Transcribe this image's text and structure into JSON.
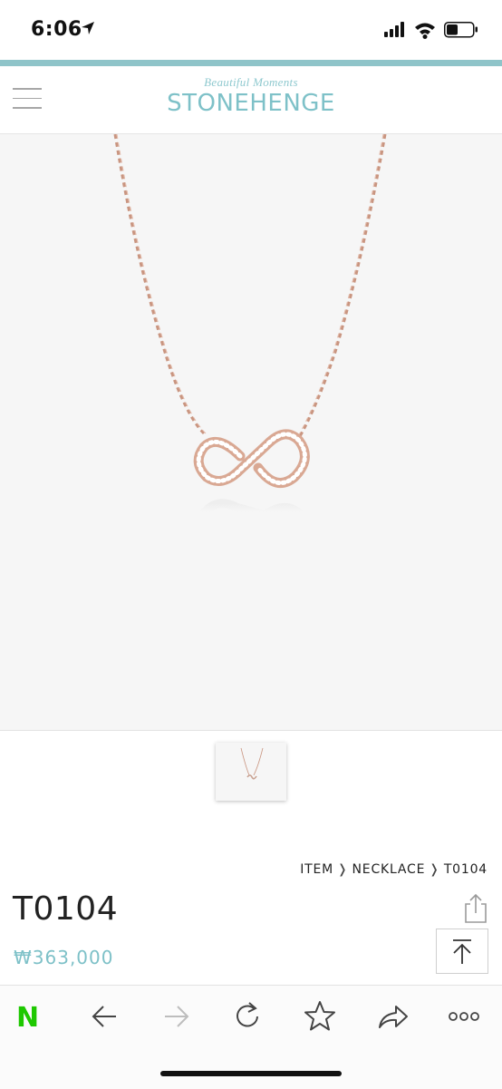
{
  "status_bar": {
    "time": "6:06"
  },
  "colors": {
    "accent": "#7ec1c8",
    "naver_green": "#1ec800"
  },
  "header": {
    "tagline": "Beautiful Moments",
    "brand": "STONEHENGE"
  },
  "breadcrumb": {
    "items": [
      "ITEM",
      "NECKLACE",
      "T0104"
    ],
    "separator": "❭"
  },
  "product": {
    "title": "T0104",
    "price": "₩363,000"
  },
  "icons": {
    "menu": "hamburger-icon",
    "share": "share-icon",
    "scroll_top": "arrow-up-icon",
    "naver": "naver-logo",
    "back": "arrow-left-icon",
    "forward": "arrow-right-icon",
    "reload": "reload-icon",
    "bookmark": "star-icon",
    "share_page": "share-arrow-icon",
    "more": "more-icon"
  },
  "browser_bar": {
    "naver_label": "N"
  }
}
